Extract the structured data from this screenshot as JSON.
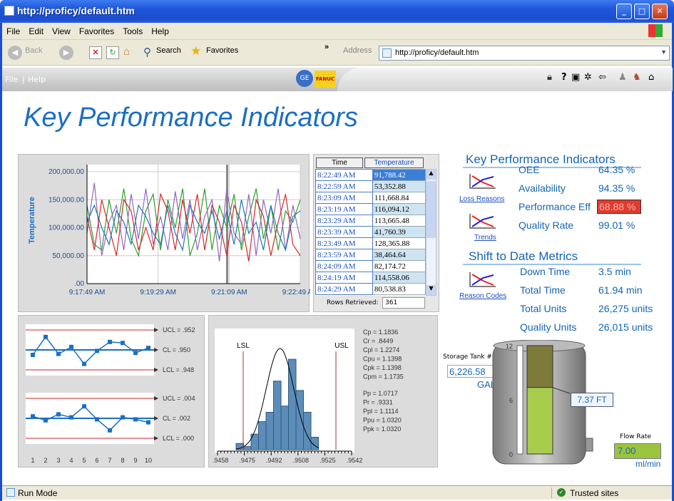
{
  "window": {
    "title": "http://proficy/default.htm"
  },
  "menu": [
    "File",
    "Edit",
    "View",
    "Favorites",
    "Tools",
    "Help"
  ],
  "toolbar": {
    "back": "Back",
    "search": "Search",
    "favorites": "Favorites",
    "address_label": "Address",
    "url": "http://proficy/default.htm"
  },
  "appbar": {
    "file": "File",
    "sep": "|",
    "help": "Help",
    "ge": "GE",
    "fanuc": "FANUC"
  },
  "page": {
    "title": "Key Performance Indicators"
  },
  "trend": {
    "ylabel": "Temperature",
    "yticks": [
      "200,000.00",
      "150,000.00",
      "100,000.00",
      "50,000.00",
      ".00"
    ],
    "xticks": [
      "9:17:49 AM",
      "9:19:29 AM",
      "9:21:09 AM",
      "9:22:49 AM"
    ]
  },
  "table": {
    "headers": [
      "Time",
      "Temperature"
    ],
    "rows": [
      [
        "8:22:49 AM",
        "91,788.42"
      ],
      [
        "8:22:59 AM",
        "53,352.88"
      ],
      [
        "8:23:09 AM",
        "111,668.84"
      ],
      [
        "8:23:19 AM",
        "116,094.12"
      ],
      [
        "8:23:29 AM",
        "113,665.48"
      ],
      [
        "8:23:39 AM",
        "41,760.39"
      ],
      [
        "8:23:49 AM",
        "128,365.88"
      ],
      [
        "8:23:59 AM",
        "38,464.64"
      ],
      [
        "8:24:09 AM",
        "82,174.72"
      ],
      [
        "8:24:19 AM",
        "114,558.06"
      ],
      [
        "8:24:29 AM",
        "80,538.83"
      ]
    ],
    "rows_label": "Rows Retrieved:",
    "rows_value": "361"
  },
  "kpi": {
    "heading": "Key Performance Indicators",
    "items": [
      {
        "label": "OEE",
        "value": "64.35 %"
      },
      {
        "label": "Availability",
        "value": "94.35 %"
      },
      {
        "label": "Performance Eff",
        "value": "68.88 %"
      },
      {
        "label": "Quality Rate",
        "value": "99.01 %"
      }
    ],
    "links": [
      "Loss Reasons",
      "Trends",
      "Reason Codes"
    ]
  },
  "shift": {
    "heading": "Shift to Date Metrics",
    "items": [
      {
        "label": "Down Time",
        "value": "3.5 min"
      },
      {
        "label": "Total Time",
        "value": "61.94 min"
      },
      {
        "label": "Total Units",
        "value": "26,275 units"
      },
      {
        "label": "Quality Units",
        "value": "26,015 units"
      }
    ]
  },
  "spc": {
    "top": {
      "ucl": "UCL = .952",
      "cl": "CL = .950",
      "lcl": "LCL = .948"
    },
    "bottom": {
      "ucl": "UCL = .004",
      "cl": "CL = .002",
      "lcl": "LCL = .000"
    },
    "xticks": [
      "1",
      "2",
      "3",
      "4",
      "5",
      "6",
      "7",
      "8",
      "9",
      "10"
    ],
    "top_values": [
      0.9495,
      0.9513,
      0.9496,
      0.9503,
      0.9486,
      0.9499,
      0.9508,
      0.9507,
      0.9497,
      0.9502
    ],
    "bottom_values": [
      0.0022,
      0.0018,
      0.0024,
      0.0021,
      0.0032,
      0.0019,
      0.0008,
      0.0021,
      0.0019,
      0.0016
    ]
  },
  "hist": {
    "lsl": "LSL",
    "usl": "USL",
    "xticks": [
      ".9458",
      ".9475",
      ".9492",
      ".9508",
      ".9525",
      ".9542"
    ],
    "counts": [
      2,
      1,
      5,
      9,
      12,
      22,
      14,
      29,
      19,
      12,
      4
    ],
    "stats1": [
      "Cp = 1.1836",
      "Cr = .8449",
      "Cpl = 1.2274",
      "Cpu = 1.1398",
      "Cpk = 1.1398",
      "Cpm = 1.1735"
    ],
    "stats2": [
      "Pp = 1.0717",
      "Pr = .9331",
      "Ppl = 1.1114",
      "Ppu = 1.0320",
      "Ppk = 1.0320"
    ]
  },
  "tank": {
    "label": "Storage Tank #1",
    "volume": "6,226.58",
    "volume_unit": "GAL",
    "level": "7.37 FT",
    "level_fraction": 0.614,
    "scale": [
      "12",
      "6",
      "0"
    ],
    "flow_label": "Flow Rate",
    "flow_value": "7.00",
    "flow_unit": "ml/min"
  },
  "status": {
    "left": "Run Mode",
    "right": "Trusted sites"
  },
  "chart_data": {
    "type": "line",
    "title": "",
    "ylabel": "Temperature",
    "xlabel": "",
    "ylim": [
      0,
      200000
    ],
    "xticks": [
      "9:17:49 AM",
      "9:19:29 AM",
      "9:21:09 AM",
      "9:22:49 AM"
    ],
    "series": [
      {
        "color": "#2ca02c",
        "values": [
          140000,
          70000,
          60000,
          150000,
          90000,
          170000,
          80000,
          50000,
          130000,
          160000,
          60000,
          150000,
          100000,
          170000,
          50000,
          90000,
          170000,
          60000,
          140000,
          100000,
          160000,
          60000,
          120000,
          170000,
          80000,
          140000,
          60000,
          130000,
          110000,
          150000
        ]
      },
      {
        "color": "#9467bd",
        "values": [
          90000,
          180000,
          50000,
          110000,
          140000,
          60000,
          160000,
          80000,
          170000,
          70000,
          120000,
          60000,
          165000,
          80000,
          150000,
          60000,
          120000,
          150000,
          40000,
          170000,
          90000,
          70000,
          160000,
          50000,
          150000,
          90000,
          170000,
          60000,
          140000,
          80000
        ]
      },
      {
        "color": "#d62728",
        "values": [
          120000,
          60000,
          150000,
          100000,
          50000,
          150000,
          130000,
          60000,
          100000,
          60000,
          160000,
          130000,
          60000,
          150000,
          90000,
          160000,
          60000,
          140000,
          110000,
          50000,
          140000,
          110000,
          40000,
          150000,
          120000,
          50000,
          110000,
          160000,
          70000,
          50000
        ]
      },
      {
        "color": "#1f77b4",
        "values": [
          110000,
          140000,
          100000,
          70000,
          130000,
          110000,
          70000,
          140000,
          120000,
          90000,
          70000,
          140000,
          90000,
          60000,
          140000,
          110000,
          90000,
          130000,
          80000,
          130000,
          70000,
          150000,
          90000,
          110000,
          60000,
          140000,
          90000,
          60000,
          120000,
          130000
        ]
      }
    ]
  }
}
